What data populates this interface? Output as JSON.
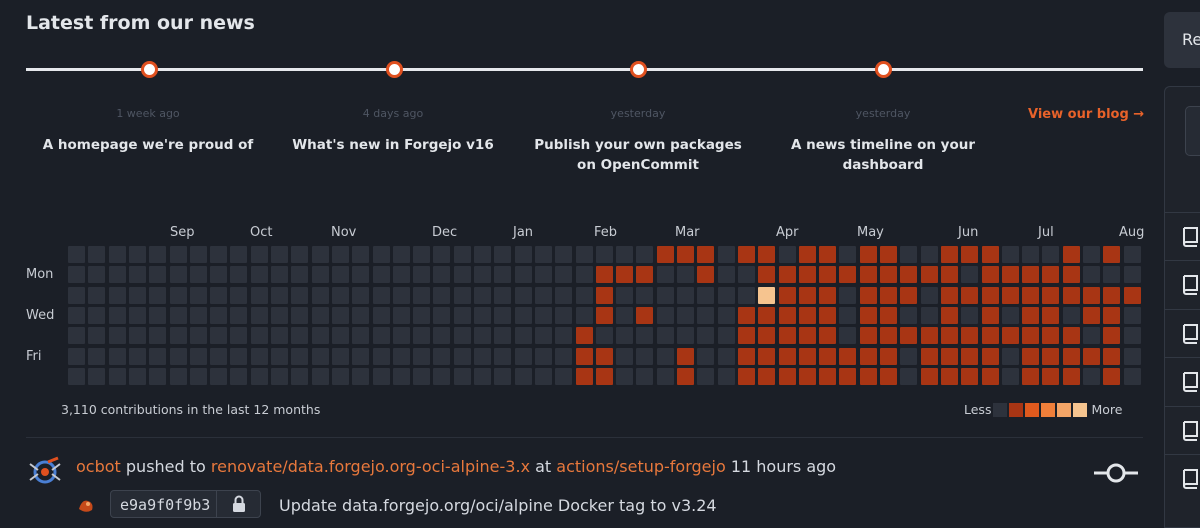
{
  "news": {
    "title": "Latest from our news",
    "items": [
      {
        "date": "1 week ago",
        "headline": "A homepage we're proud of"
      },
      {
        "date": "4 days ago",
        "headline": "What's new in Forgejo v16"
      },
      {
        "date": "yesterday",
        "headline": "Publish your own packages on OpenCommit"
      },
      {
        "date": "yesterday",
        "headline": "A news timeline on your dashboard"
      }
    ],
    "view_blog": "View our blog →"
  },
  "heatmap": {
    "months": [
      "Sep",
      "Oct",
      "Nov",
      "Dec",
      "Jan",
      "Feb",
      "Mar",
      "Apr",
      "May",
      "Jun",
      "Jul",
      "Aug"
    ],
    "day_labels": [
      "Mon",
      "Wed",
      "Fri"
    ],
    "summary": "3,110 contributions in the last 12 months",
    "legend_less": "Less",
    "legend_more": "More",
    "colors": [
      "#2d323c",
      "#a83514",
      "#e05a1e",
      "#f07f3a",
      "#f4a567",
      "#f6c48f"
    ],
    "level_counts": {
      "0": 172,
      "1": 192,
      "5": 1
    }
  },
  "feed": {
    "actor": "ocbot",
    "action": " pushed to ",
    "branch": "renovate/data.forgejo.org-oci-alpine-3.x",
    "at": " at ",
    "repo": "actions/setup-forgejo",
    "time": " 11 hours ago",
    "commit_sha": "e9a9f0f9b3",
    "commit_message": "Update data.forgejo.org/oci/alpine Docker tag to v3.24"
  },
  "sidebar": {
    "button_label": "Re"
  }
}
